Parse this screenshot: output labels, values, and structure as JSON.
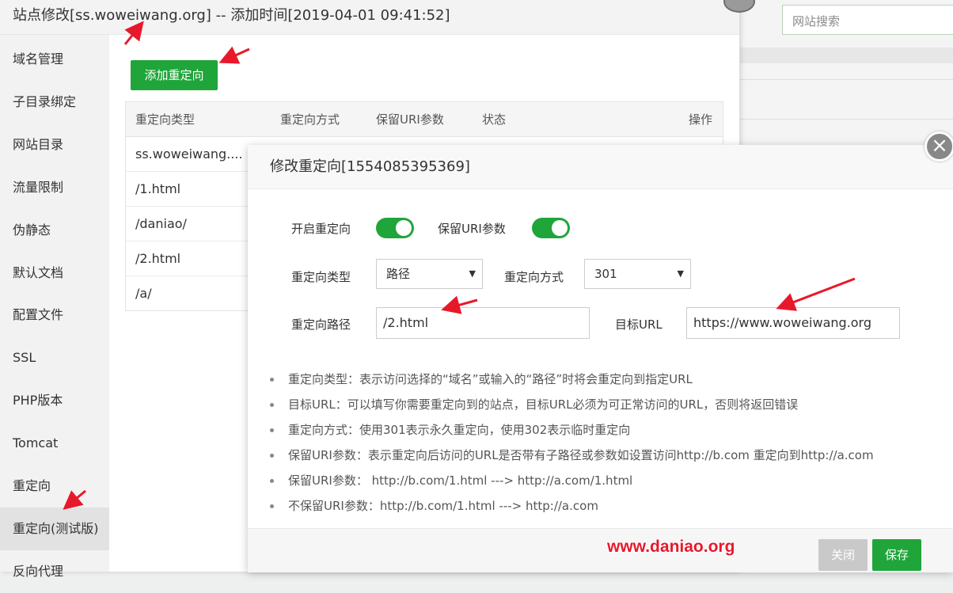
{
  "background": {
    "search_placeholder": "网站搜索"
  },
  "window": {
    "title": "站点修改[ss.woweiwang.org] -- 添加时间[2019-04-01 09:41:52]"
  },
  "sidebar": {
    "items": [
      {
        "label": "域名管理"
      },
      {
        "label": "子目录绑定"
      },
      {
        "label": "网站目录"
      },
      {
        "label": "流量限制"
      },
      {
        "label": "伪静态"
      },
      {
        "label": "默认文档"
      },
      {
        "label": "配置文件"
      },
      {
        "label": "SSL"
      },
      {
        "label": "PHP版本"
      },
      {
        "label": "Tomcat"
      },
      {
        "label": "重定向"
      },
      {
        "label": "重定向(测试版)"
      },
      {
        "label": "反向代理"
      }
    ],
    "active": "重定向(测试版)"
  },
  "main": {
    "add_button": "添加重定向",
    "table": {
      "columns": [
        "重定向类型",
        "重定向方式",
        "保留URI参数",
        "状态",
        "操作"
      ],
      "rows": [
        "ss.woweiwang....",
        "/1.html",
        "/daniao/",
        "/2.html",
        "/a/"
      ]
    }
  },
  "modal": {
    "title": "修改重定向[1554085395369]",
    "enable_label": "开启重定向",
    "enable_on": true,
    "keep_uri_label": "保留URI参数",
    "keep_uri_on": true,
    "type_label": "重定向类型",
    "type_value": "路径",
    "method_label": "重定向方式",
    "method_value": "301",
    "path_label": "重定向路径",
    "path_value": "/2.html",
    "target_label": "目标URL",
    "target_value": "https://www.woweiwang.org",
    "notes": [
      "重定向类型：表示访问选择的“域名”或输入的“路径”时将会重定向到指定URL",
      "目标URL：可以填写你需要重定向到的站点，目标URL必须为可正常访问的URL，否则将返回错误",
      "重定向方式：使用301表示永久重定向，使用302表示临时重定向",
      "保留URI参数：表示重定向后访问的URL是否带有子路径或参数如设置访问http://b.com 重定向到http://a.com",
      "保留URI参数：  http://b.com/1.html ---> http://a.com/1.html",
      "不保留URI参数：http://b.com/1.html ---> http://a.com"
    ],
    "close_button": "关闭",
    "save_button": "保存"
  },
  "watermark": "www.daniao.org",
  "colors": {
    "accent": "#20a53a",
    "annotation_arrow": "#e8182b"
  }
}
